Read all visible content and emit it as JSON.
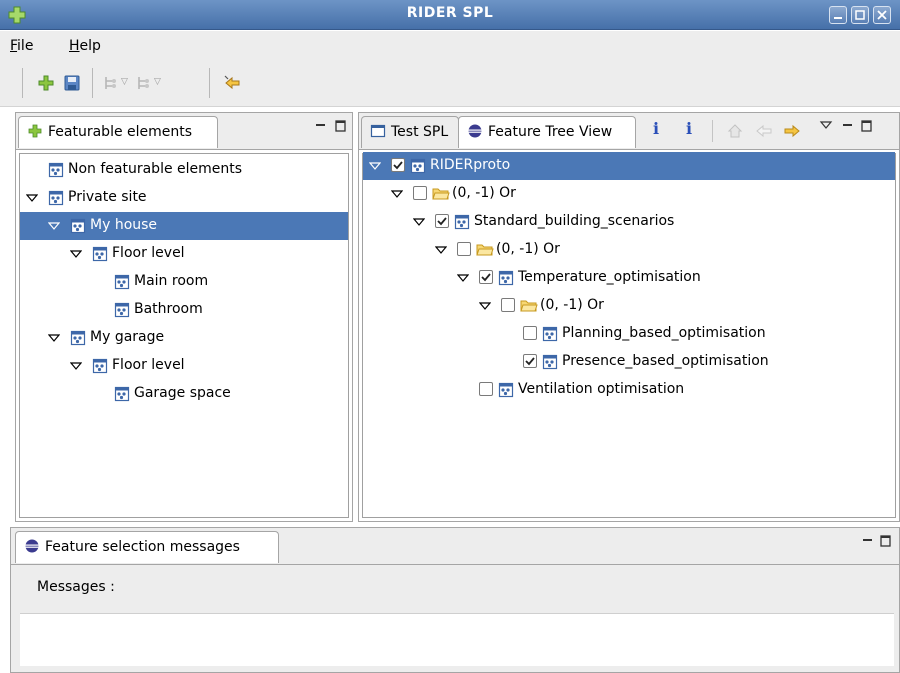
{
  "window": {
    "title": "RIDER SPL"
  },
  "menu": {
    "file": "File",
    "file_rest": "ile",
    "file_mn": "F",
    "help_mn": "H",
    "help_rest": "elp"
  },
  "left_panel": {
    "tab_label": "Featurable elements",
    "tree": [
      {
        "label": "Non featurable elements"
      },
      {
        "label": "Private site"
      },
      {
        "label": "My house"
      },
      {
        "label": "Floor level"
      },
      {
        "label": "Main room"
      },
      {
        "label": "Bathroom"
      },
      {
        "label": "My garage"
      },
      {
        "label": "Floor level"
      },
      {
        "label": "Garage space"
      }
    ]
  },
  "right_panel": {
    "tabs": [
      {
        "label": "Test SPL"
      },
      {
        "label": "Feature Tree View"
      }
    ],
    "info_glyph": "i",
    "tree": [
      {
        "label": "RIDERproto",
        "checked": true
      },
      {
        "label": "(0, -1) Or",
        "checked": false
      },
      {
        "label": "Standard_building_scenarios",
        "checked": true
      },
      {
        "label": "(0, -1) Or",
        "checked": false
      },
      {
        "label": "Temperature_optimisation",
        "checked": true
      },
      {
        "label": "(0, -1) Or",
        "checked": false
      },
      {
        "label": "Planning_based_optimisation",
        "checked": false
      },
      {
        "label": "Presence_based_optimisation",
        "checked": true
      },
      {
        "label": "Ventilation optimisation",
        "checked": false
      }
    ]
  },
  "bottom_panel": {
    "tab_label": "Feature selection messages",
    "messages_label": "Messages :"
  },
  "colors": {
    "selection": "#4b78b6",
    "titlebar": "#5a80b5",
    "chrome": "#ededed"
  }
}
